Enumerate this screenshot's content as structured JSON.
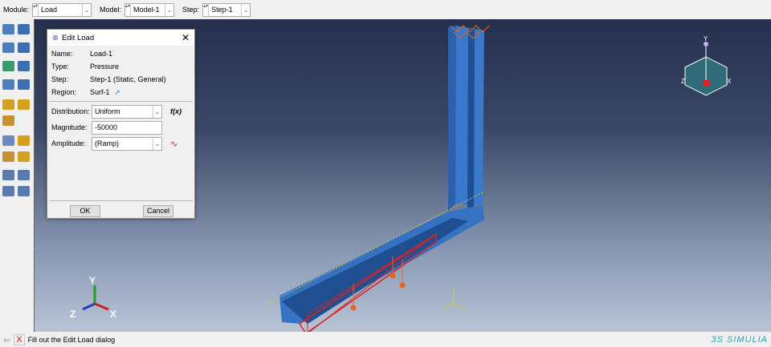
{
  "toolbar": {
    "module_label": "Module:",
    "module_value": "Load",
    "model_label": "Model:",
    "model_value": "Model-1",
    "step_label": "Step:",
    "step_value": "Step-1"
  },
  "dialog": {
    "title": "Edit Load",
    "name_label": "Name:",
    "name_value": "Load-1",
    "type_label": "Type:",
    "type_value": "Pressure",
    "step_label": "Step:",
    "step_value": "Step-1 (Static, General)",
    "region_label": "Region:",
    "region_value": "Surf-1",
    "distribution_label": "Distribution:",
    "distribution_value": "Uniform",
    "fx_label": "f(x)",
    "magnitude_label": "Magnitude:",
    "magnitude_value": "-50000",
    "amplitude_label": "Amplitude:",
    "amplitude_value": "(Ramp)",
    "ok_label": "OK",
    "cancel_label": "Cancel"
  },
  "triad": {
    "y": "Y",
    "x": "X",
    "z": "Z"
  },
  "status": {
    "message": "Fill out the Edit Load dialog",
    "brand": "SIMULIA",
    "brand_mark": "3S"
  },
  "colors": {
    "beam": "#2f6fc4",
    "load": "#e8641e",
    "selection": "#e02020"
  }
}
